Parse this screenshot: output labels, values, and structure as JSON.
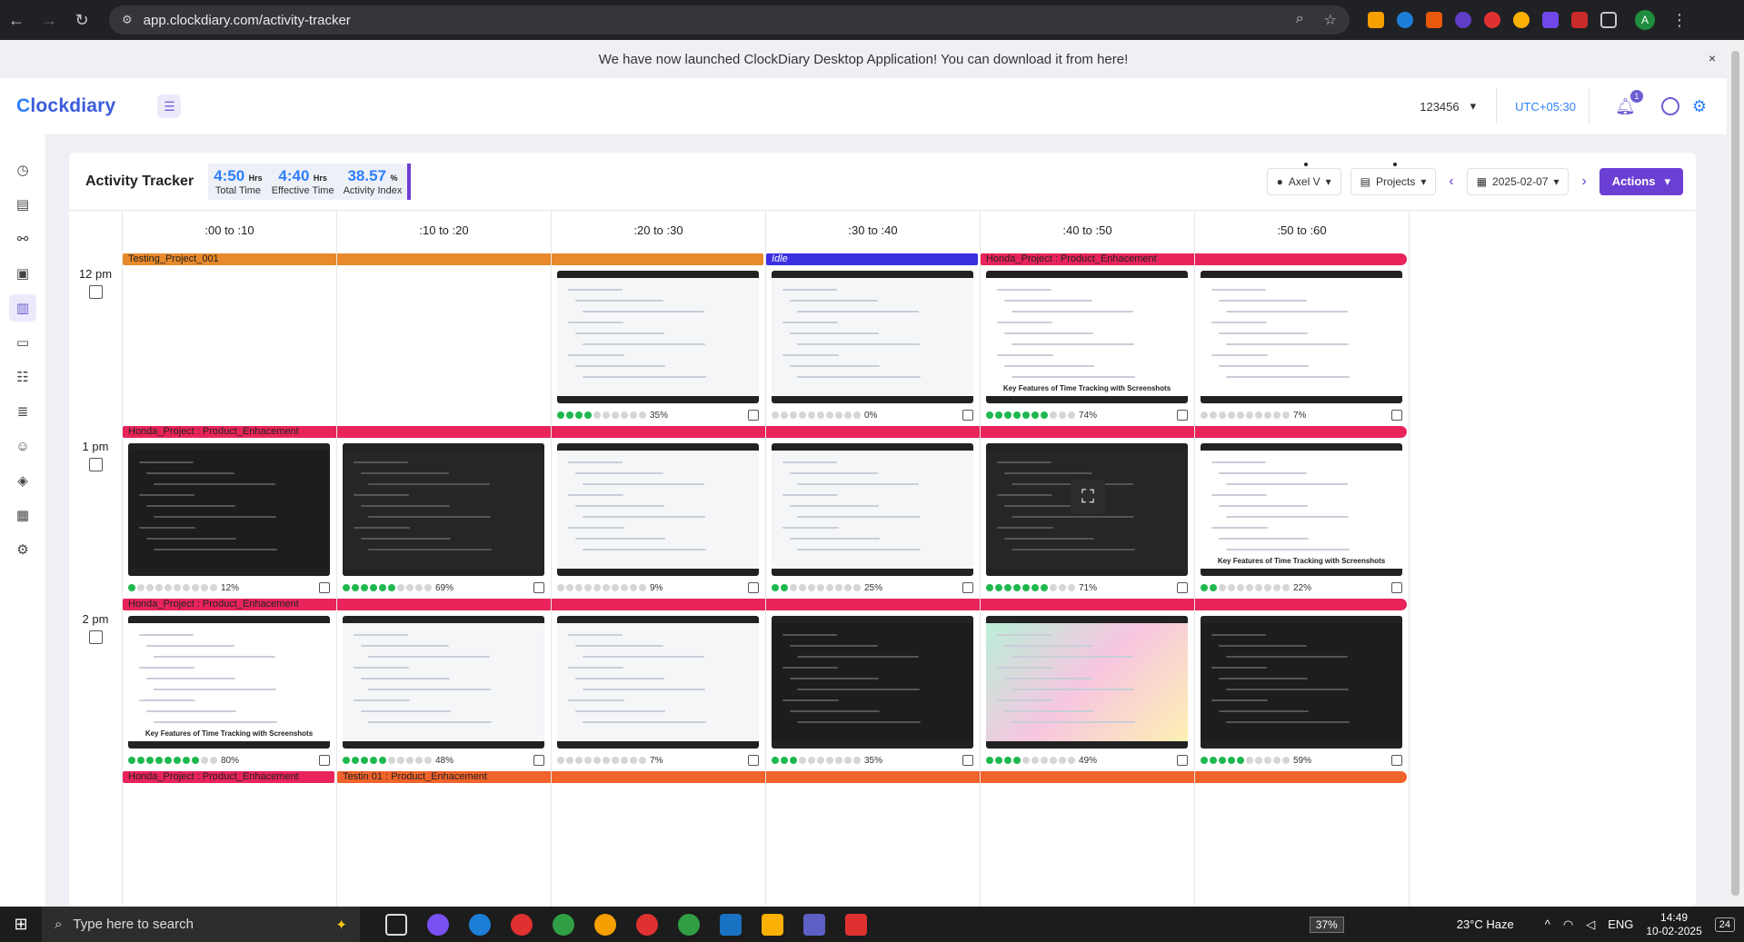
{
  "browser": {
    "url": "app.clockdiary.com/activity-tracker",
    "profile_initial": "A"
  },
  "banner": {
    "text": "We have now launched ClockDiary Desktop Application! You can download it from here!",
    "close": "×"
  },
  "header": {
    "logo": "lockdiary",
    "logo_c": "C",
    "org": "123456",
    "timezone": "UTC+05:30",
    "notifications": "1"
  },
  "tracker": {
    "title": "Activity Tracker",
    "stats": [
      {
        "value": "4:50",
        "unit": "Hrs",
        "label": "Total Time"
      },
      {
        "value": "4:40",
        "unit": "Hrs",
        "label": "Effective Time"
      },
      {
        "value": "38.57",
        "unit": "%",
        "label": "Activity Index"
      }
    ],
    "user_filter": "Axel V",
    "project_filter": "Projects",
    "date": "2025-02-07",
    "actions": "Actions"
  },
  "columns": [
    ":00 to :10",
    ":10 to :20",
    ":20 to :30",
    ":30 to :40",
    ":40 to :50",
    ":50 to :60"
  ],
  "rows": [
    {
      "hour": "12 pm",
      "bars": [
        {
          "text": "Testing_Project_001",
          "start": 0,
          "span": 3,
          "color": "#e8892b",
          "italic": false
        },
        {
          "text": "Idle",
          "start": 3,
          "span": 1,
          "color": "#3b2fe0",
          "italic": true
        },
        {
          "text": "Honda_Project : Product_Enhacement",
          "start": 4,
          "span": 2,
          "color": "#e8245a",
          "italic": false
        }
      ],
      "shots": [
        null,
        null,
        {
          "theme": "light",
          "percent": "35%",
          "active": 4
        },
        {
          "theme": "light",
          "percent": "0%",
          "active": 0
        },
        {
          "theme": "promo",
          "percent": "74%",
          "active": 7,
          "caption": "Key Features of Time Tracking with Screenshots"
        },
        {
          "theme": "sheet",
          "percent": "7%",
          "active": 0
        }
      ]
    },
    {
      "hour": "1 pm",
      "bars": [
        {
          "text": "Honda_Project : Product_Enhacement",
          "start": 0,
          "span": 6,
          "color": "#e8245a",
          "italic": false
        }
      ],
      "shots": [
        {
          "theme": "dark",
          "percent": "12%",
          "active": 1
        },
        {
          "theme": "mixed",
          "percent": "69%",
          "active": 6
        },
        {
          "theme": "light",
          "percent": "9%",
          "active": 0
        },
        {
          "theme": "light",
          "percent": "25%",
          "active": 2
        },
        {
          "theme": "mixed",
          "percent": "71%",
          "active": 7
        },
        {
          "theme": "promo",
          "percent": "22%",
          "active": 2,
          "caption": "Key Features of Time Tracking with Screenshots"
        }
      ]
    },
    {
      "hour": "2 pm",
      "bars": [
        {
          "text": "Honda_Project : Product_Enhacement",
          "start": 0,
          "span": 6,
          "color": "#e8245a",
          "italic": false
        }
      ],
      "shots": [
        {
          "theme": "promo",
          "percent": "80%",
          "active": 8,
          "caption": "Key Features of Time Tracking with Screenshots"
        },
        {
          "theme": "light",
          "percent": "48%",
          "active": 5
        },
        {
          "theme": "light",
          "percent": "7%",
          "active": 0
        },
        {
          "theme": "dark",
          "percent": "35%",
          "active": 3
        },
        {
          "theme": "gradient",
          "percent": "49%",
          "active": 4
        },
        {
          "theme": "dark",
          "percent": "59%",
          "active": 5
        }
      ]
    },
    {
      "hour": "",
      "bars": [
        {
          "text": "Honda_Project : Product_Enhacement",
          "start": 0,
          "span": 1,
          "color": "#e8245a",
          "italic": false
        },
        {
          "text": "Testin 01 : Product_Enhacement",
          "start": 1,
          "span": 5,
          "color": "#f0632a",
          "italic": false
        }
      ],
      "shots": []
    }
  ],
  "taskbar": {
    "search_placeholder": "Type here to search",
    "battery": "37%",
    "weather": "23°C  Haze",
    "language": "ENG",
    "time": "14:49",
    "date": "10-02-2025",
    "notif_count": "24"
  },
  "colors": {
    "accent": "#6b3fd3",
    "brand_blue": "#2d7ff9",
    "activity_green": "#1fb84f"
  }
}
